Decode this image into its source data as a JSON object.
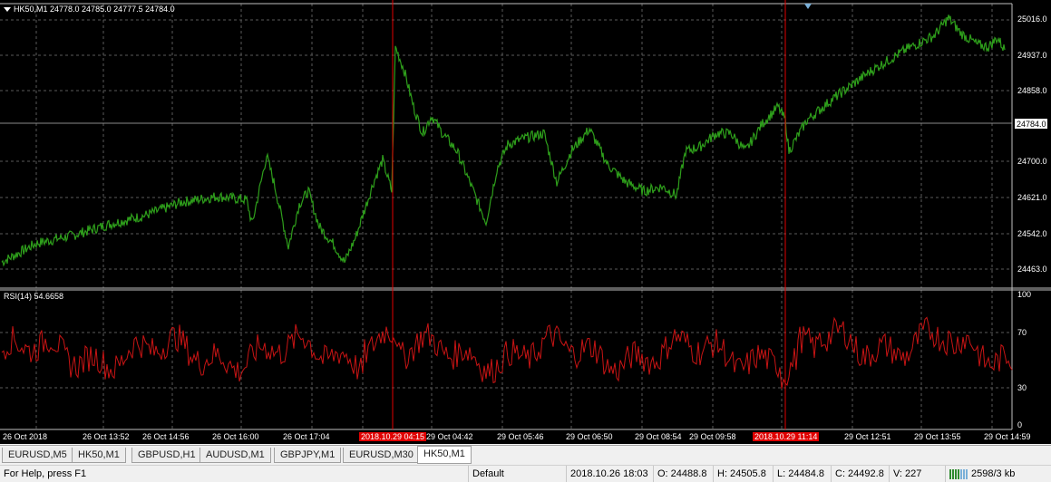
{
  "chart": {
    "header": "HK50,M1  24778.0 24785.0 24777.5 24784.0",
    "rsi_header": "RSI(14) 54.6658",
    "price_labels": [
      "25016.0",
      "24937.0",
      "24858.0",
      "24700.0",
      "24621.0",
      "24542.0",
      "24463.0"
    ],
    "current_price": "24784.0",
    "rsi_labels": [
      "100",
      "70",
      "30",
      "0"
    ],
    "time_labels": [
      "26 Oct 2018",
      "26 Oct 13:52",
      "26 Oct 14:56",
      "26 Oct 16:00",
      "26 Oct 17:04",
      "2018.10.29 04:15",
      "29 Oct 04:42",
      "29 Oct 05:46",
      "29 Oct 06:50",
      "29 Oct 08:54",
      "29 Oct 09:58",
      "2018.10.29 11:14",
      "29 Oct 12:51",
      "29 Oct 13:55",
      "29 Oct 14:59"
    ],
    "colors": {
      "background": "#000000",
      "price_line": "#2e9e1b",
      "rsi_line": "#c81414",
      "grid": "#5a5a5a",
      "marker": "#e00000"
    }
  },
  "tabs": [
    "EURUSD,M5",
    "HK50,M1",
    "GBPUSD,H1",
    "AUDUSD,M1",
    "GBPJPY,M1",
    "EURUSD,M30",
    "HK50,M1"
  ],
  "active_tab_index": 6,
  "status": {
    "help": "For Help, press F1",
    "profile": "Default",
    "datetime": "2018.10.26 18:03",
    "open": "O: 24488.8",
    "high": "H: 24505.8",
    "low": "L: 24484.8",
    "close": "C: 24492.8",
    "volume": "V: 227",
    "traffic": "2598/3 kb",
    "traffic_icon": "connection-bars-icon"
  }
}
